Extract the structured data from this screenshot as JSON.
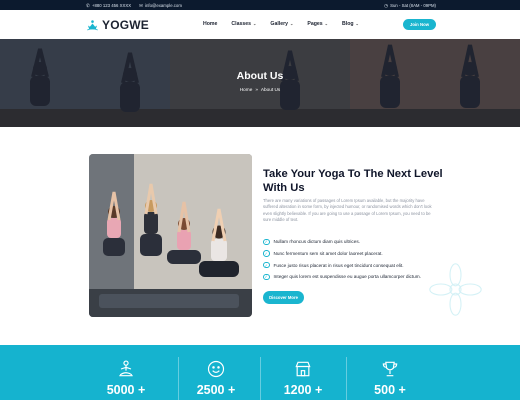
{
  "topbar": {
    "phone": "+880 123 456 XXXX",
    "email": "info@example.com",
    "hours": "Sun - Sat (8AM - 09PM)"
  },
  "nav": {
    "logo_text": "YOGWE",
    "items": [
      {
        "label": "Home"
      },
      {
        "label": "Classes"
      },
      {
        "label": "Gallery"
      },
      {
        "label": "Pages"
      },
      {
        "label": "Blog"
      }
    ],
    "join_label": "Join Now"
  },
  "hero": {
    "title": "About Us",
    "breadcrumb": [
      "Home",
      "About Us"
    ]
  },
  "about": {
    "heading": "Take Your Yoga To The Next Level With Us",
    "paragraph": "There are many variations of passages of Lorem Ipsum available, but the majority have suffered alteration in some form, by injected humour, or randomised words which don't look even slightly believable. If you are going to use a passage of Lorem Ipsum, you need to be sure middle of text.",
    "checklist": [
      "Nullam rhoncus dictum diam quis ultrices.",
      "Nunc fermentum sem sit amet dolor laoreet placerat.",
      "Fusce justo risus placerat in risus eget tincidunt consequat elit.",
      "Integer quis lorem est suspendisse eu augue porta ullamcorper dictum."
    ],
    "button_label": "Discover More"
  },
  "stats": [
    {
      "value": "5000 +",
      "icon": "meditation-icon"
    },
    {
      "value": "2500 +",
      "icon": "smiley-icon"
    },
    {
      "value": "1200 +",
      "icon": "store-icon"
    },
    {
      "value": "500 +",
      "icon": "trophy-icon"
    }
  ],
  "colors": {
    "accent": "#1ab5cf",
    "topbar": "#0c1a2e",
    "stats_bg": "#15b3cf"
  }
}
